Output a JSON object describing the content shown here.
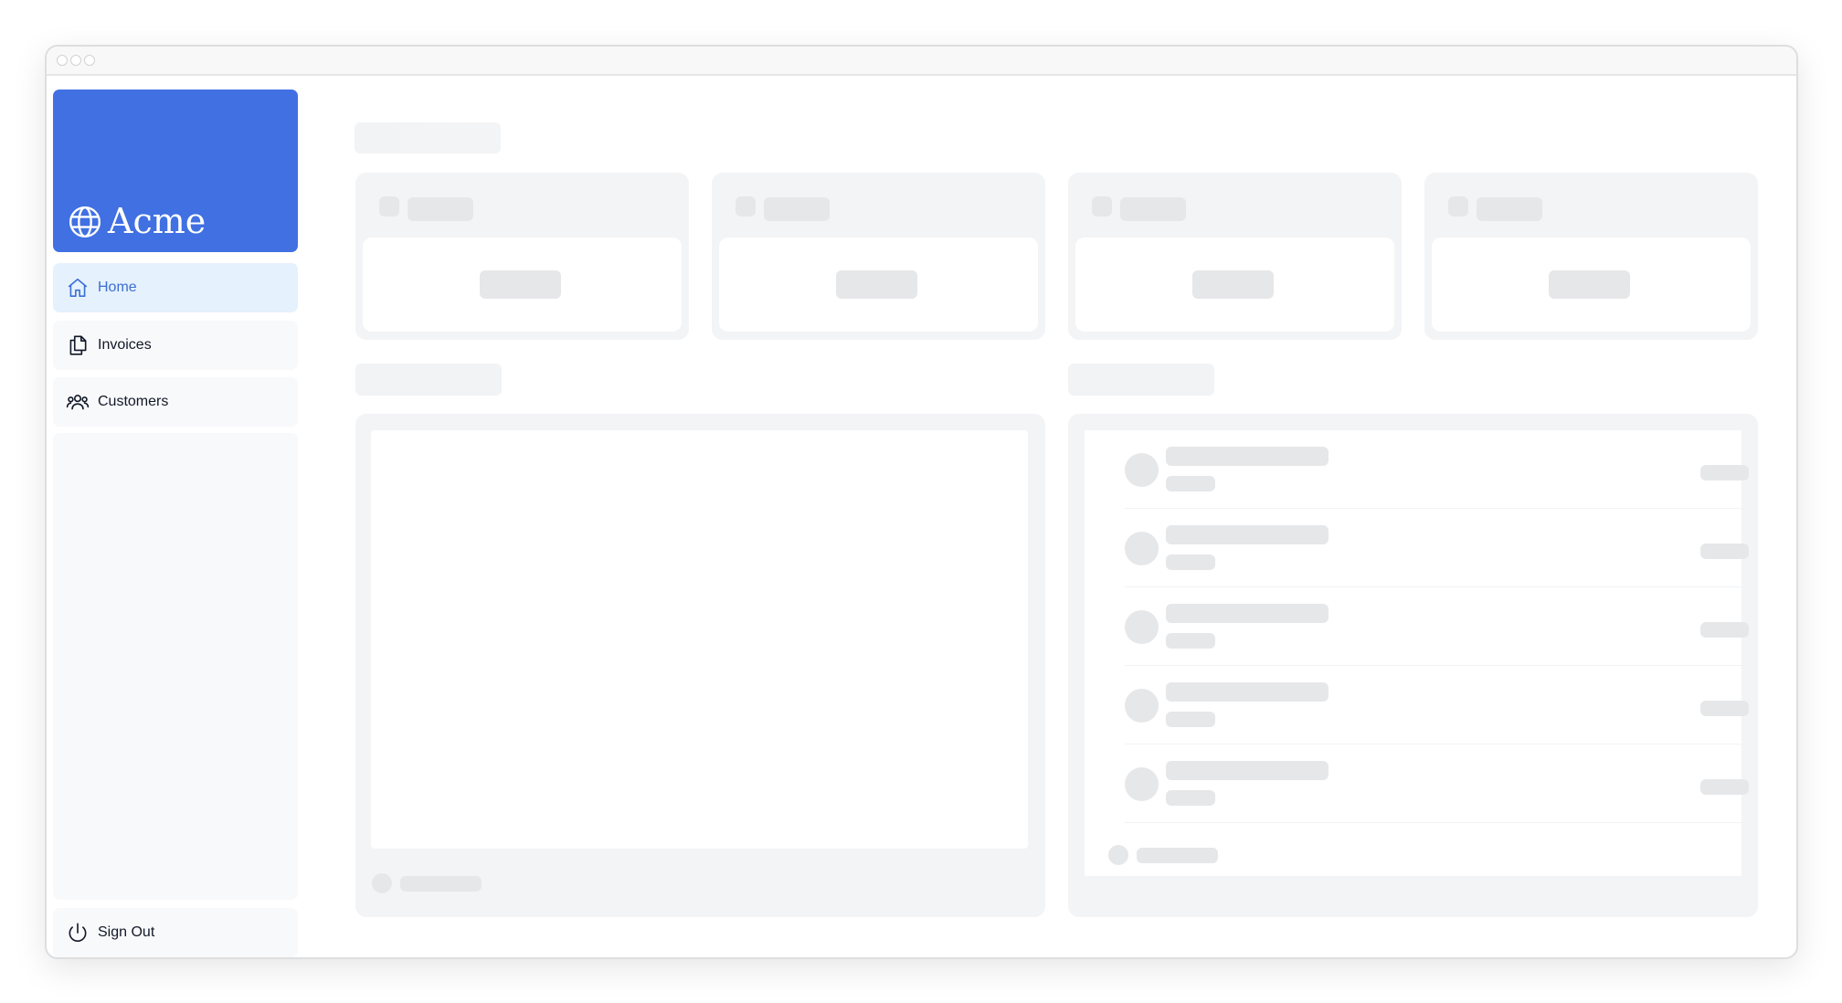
{
  "app": {
    "name": "Acme",
    "brand_color": "#4070e2",
    "active_color": "#3b6fd4",
    "active_bg": "#e5f1fc",
    "skeleton_color": "#e6e7e9"
  },
  "sidebar": {
    "items": [
      {
        "label": "Home",
        "icon": "home-icon",
        "active": true
      },
      {
        "label": "Invoices",
        "icon": "documents-icon",
        "active": false
      },
      {
        "label": "Customers",
        "icon": "users-icon",
        "active": false
      }
    ],
    "sign_out": {
      "label": "Sign Out",
      "icon": "power-icon"
    }
  },
  "dashboard": {
    "state": "loading",
    "stat_card_count": 4,
    "latest_row_count": 5
  }
}
